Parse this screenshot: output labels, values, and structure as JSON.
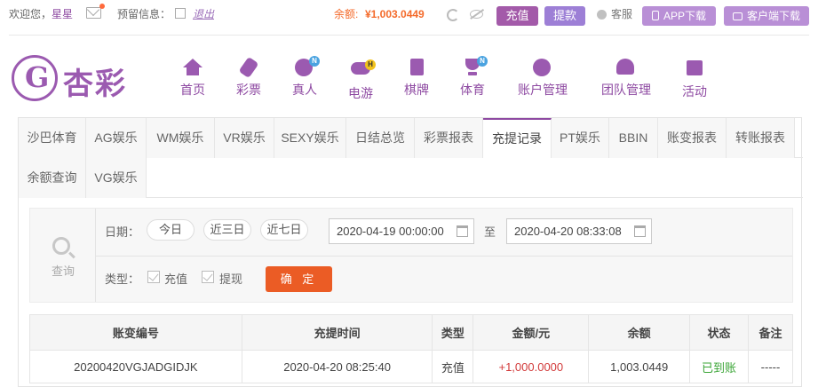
{
  "topbar": {
    "welcome": "欢迎您，",
    "username": "星星",
    "reserve_label": "预留信息：",
    "logout": "退出",
    "balance_label": "余额:",
    "balance_value": "¥1,003.0449",
    "deposit": "充值",
    "withdraw": "提款",
    "service": "客服",
    "app_download": "APP下载",
    "client_download": "客户端下载"
  },
  "logo": {
    "text": "杏彩"
  },
  "nav": [
    {
      "label": "首页",
      "icon": "home-icon"
    },
    {
      "label": "彩票",
      "icon": "lottery-icon"
    },
    {
      "label": "真人",
      "icon": "live-dealer-icon",
      "badge": "N"
    },
    {
      "label": "电游",
      "icon": "gamepad-icon",
      "badge": "H"
    },
    {
      "label": "棋牌",
      "icon": "cards-icon"
    },
    {
      "label": "体育",
      "icon": "trophy-icon",
      "badge": "N"
    },
    {
      "label": "账户管理",
      "icon": "yen-icon"
    },
    {
      "label": "团队管理",
      "icon": "team-icon"
    },
    {
      "label": "活动",
      "icon": "gift-icon"
    }
  ],
  "tabs": [
    "沙巴体育",
    "AG娱乐",
    "WM娱乐",
    "VR娱乐",
    "SEXY娱乐",
    "日结总览",
    "彩票报表",
    "充提记录",
    "PT娱乐",
    "BBIN",
    "账变报表",
    "转账报表",
    "余额查询",
    "VG娱乐"
  ],
  "active_tab": "充提记录",
  "search": {
    "side_label": "查询",
    "date_label": "日期：",
    "quick": [
      "今日",
      "近三日",
      "近七日"
    ],
    "start": "2020-04-19 00:00:00",
    "to": "至",
    "end": "2020-04-20 08:33:08",
    "type_label": "类型：",
    "types": [
      "充值",
      "提现"
    ],
    "confirm": "确 定"
  },
  "table": {
    "headers": [
      "账变编号",
      "充提时间",
      "类型",
      "金额/元",
      "余额",
      "状态",
      "备注"
    ],
    "rows": [
      [
        "20200420VGJADGIDJK",
        "2020-04-20 08:25:40",
        "充值",
        "+1,000.0000",
        "1,003.0449",
        "已到账",
        "-----"
      ]
    ]
  },
  "colors": {
    "brand": "#8e4aa2",
    "accent": "#eb5c25",
    "balance": "#f46a2a",
    "success": "#3aa536",
    "amount": "#d23b3b"
  }
}
